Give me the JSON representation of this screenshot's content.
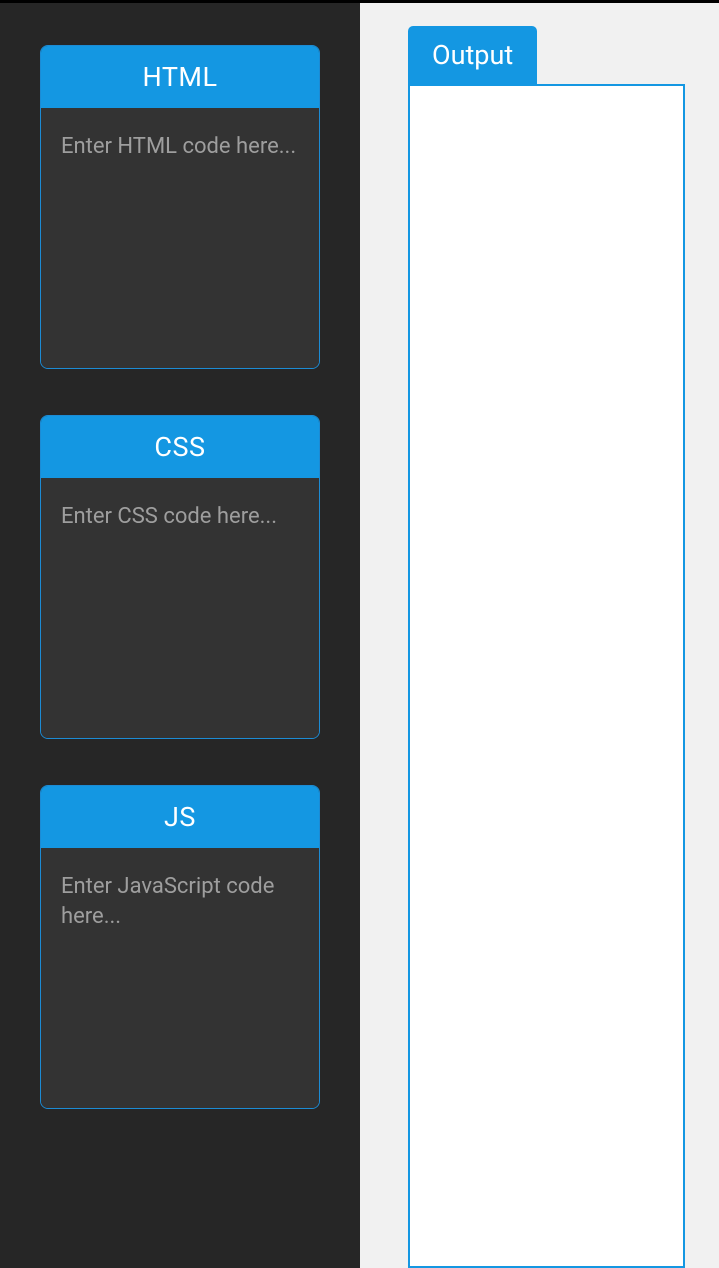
{
  "editors": {
    "html": {
      "label": "HTML",
      "placeholder": "Enter HTML code here..."
    },
    "css": {
      "label": "CSS",
      "placeholder": "Enter CSS code here..."
    },
    "js": {
      "label": "JS",
      "placeholder": "Enter JavaScript code here..."
    }
  },
  "output": {
    "label": "Output"
  }
}
